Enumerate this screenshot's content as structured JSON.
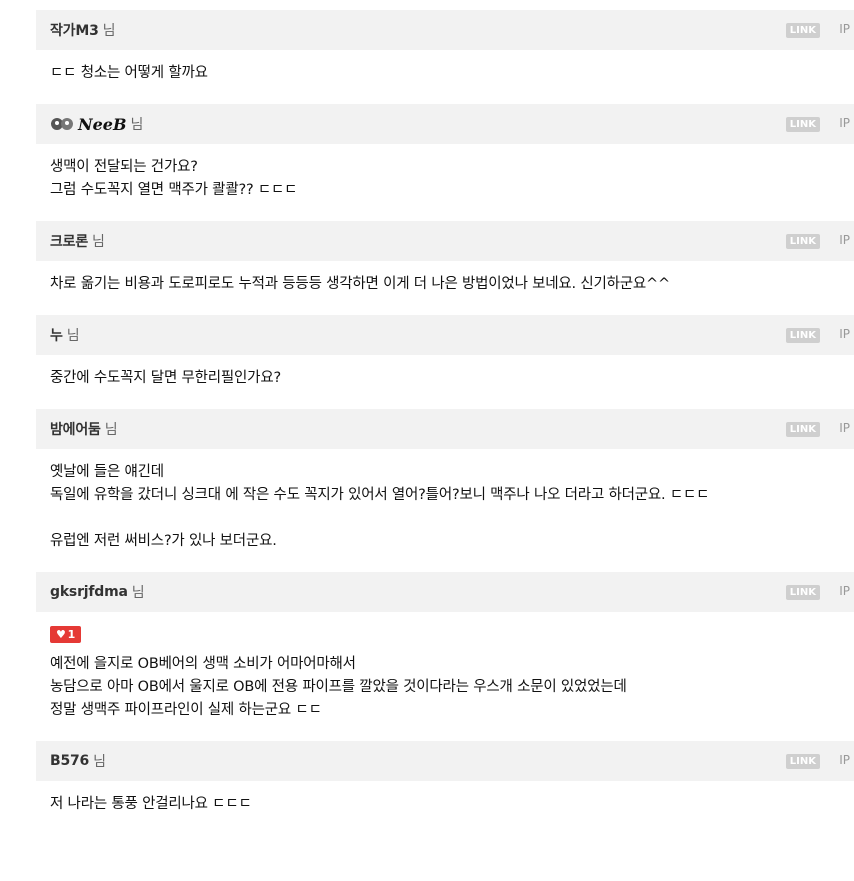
{
  "comments": [
    {
      "nick": "작가M3",
      "suffix": "님",
      "link": "LINK",
      "ip": "IP",
      "lines": [
        "ㄷㄷ 청소는 어떻게 할까요"
      ]
    },
    {
      "nick": "NeeB",
      "suffix": "님",
      "link": "LINK",
      "ip": "IP",
      "nick_is_image": true,
      "lines": [
        "생맥이 전달되는 건가요?",
        "그럼 수도꼭지 열면 맥주가 콸콸?? ㄷㄷㄷ"
      ]
    },
    {
      "nick": "크로론",
      "suffix": "님",
      "link": "LINK",
      "ip": "IP",
      "lines": [
        "차로 옮기는 비용과 도로피로도 누적과 등등등 생각하면 이게 더 나은 방법이었나 보네요. 신기하군요^^"
      ]
    },
    {
      "nick": "누",
      "suffix": "님",
      "link": "LINK",
      "ip": "IP",
      "lines": [
        "중간에 수도꼭지 달면 무한리필인가요?"
      ]
    },
    {
      "nick": "밤에어둠",
      "suffix": "님",
      "link": "LINK",
      "ip": "IP",
      "lines": [
        "옛날에 들은 얘긴데",
        "독일에 유학을 갔더니 싱크대 에 작은 수도 꼭지가 있어서 열어?틀어?보니 맥주나 나오 더라고 하더군요. ㄷㄷㄷ",
        "",
        "유럽엔 저런 써비스?가 있나 보더군요."
      ]
    },
    {
      "nick": "gksrjfdma",
      "suffix": "님",
      "link": "LINK",
      "ip": "IP",
      "likes": "1",
      "lines": [
        "예전에 을지로 OB베어의 생맥 소비가 어마어마해서",
        "농담으로 아마 OB에서 울지로 OB에 전용 파이프를 깔았을 것이다라는 우스개 소문이 있었었는데",
        "정말 생맥주 파이프라인이 실제 하는군요 ㄷㄷ"
      ]
    },
    {
      "nick": "B576",
      "suffix": "님",
      "link": "LINK",
      "ip": "IP",
      "lines": [
        "저 나라는 통풍 안걸리나요 ㄷㄷㄷ"
      ]
    }
  ],
  "icons": {
    "like": "heart-icon"
  },
  "colors": {
    "header_bg": "#f2f2f2",
    "like_badge": "#e53935",
    "link_badge": "#cfcfcf"
  }
}
